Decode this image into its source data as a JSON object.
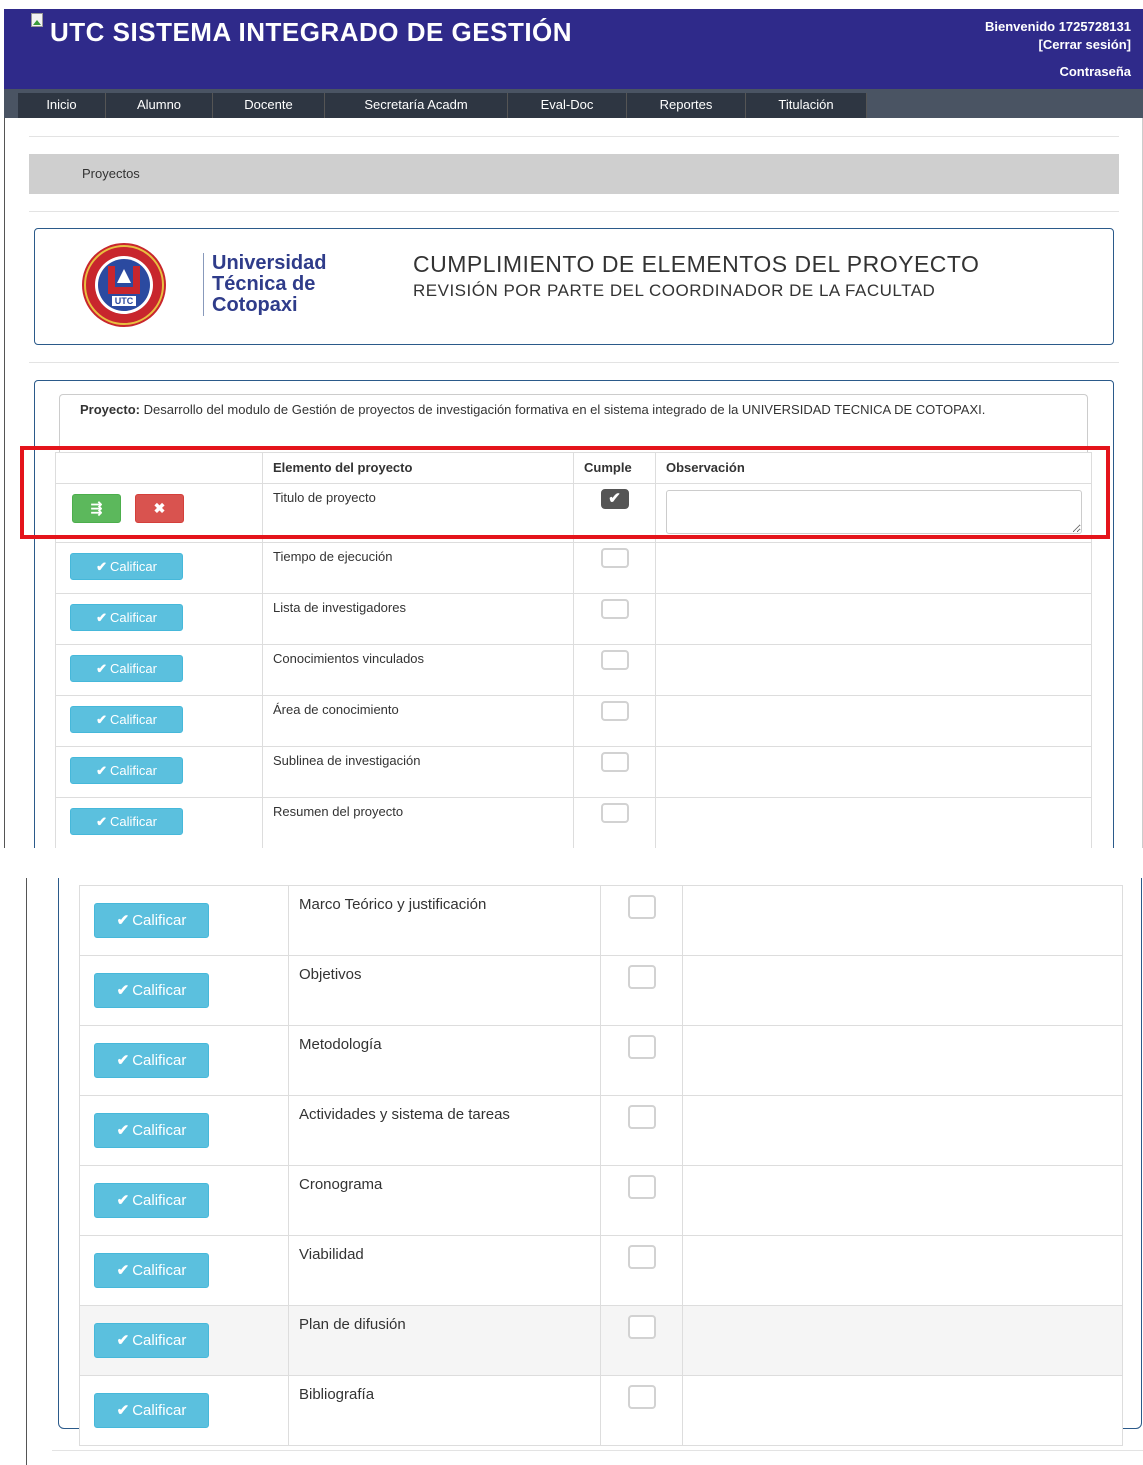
{
  "header": {
    "title": "UTC SISTEMA INTEGRADO DE GESTIÓN",
    "welcome": "Bienvenido 1725728131",
    "logout": "[Cerrar sesión]",
    "password": "Contraseña"
  },
  "nav": [
    "Inicio",
    "Alumno",
    "Docente",
    "Secretaría Acadm",
    "Eval-Doc",
    "Reportes",
    "Titulación"
  ],
  "breadcrumb": "Proyectos",
  "university": {
    "line1": "Universidad",
    "line2": "Técnica de",
    "line3": "Cotopaxi"
  },
  "page": {
    "title": "CUMPLIMIENTO DE ELEMENTOS DEL PROYECTO",
    "subtitle": "REVISIÓN POR PARTE DEL COORDINADOR DE LA FACULTAD"
  },
  "project": {
    "label": "Proyecto:",
    "name": "Desarrollo del modulo de Gestión de proyectos de investigación formativa en el sistema integrado de la UNIVERSIDAD TECNICA DE COTOPAXI."
  },
  "table": {
    "headers": {
      "action": "",
      "element": "Elemento del proyecto",
      "cumple": "Cumple",
      "observacion": "Observación"
    },
    "button_label": "Calificar",
    "rows": [
      {
        "element": "Titulo de proyecto",
        "cumple": true,
        "editing": true
      },
      {
        "element": "Tiempo de ejecución",
        "cumple": false
      },
      {
        "element": "Lista de investigadores",
        "cumple": false
      },
      {
        "element": "Conocimientos vinculados",
        "cumple": false
      },
      {
        "element": "Área de conocimiento",
        "cumple": false
      },
      {
        "element": "Sublinea de investigación",
        "cumple": false
      },
      {
        "element": "Resumen del proyecto",
        "cumple": false
      },
      {
        "element": "Marco Teórico y justificación",
        "cumple": false
      },
      {
        "element": "Objetivos",
        "cumple": false
      },
      {
        "element": "Metodología",
        "cumple": false
      },
      {
        "element": "Actividades y sistema de tareas",
        "cumple": false
      },
      {
        "element": "Cronograma",
        "cumple": false
      },
      {
        "element": "Viabilidad",
        "cumple": false
      },
      {
        "element": "Plan de difusión",
        "cumple": false
      },
      {
        "element": "Bibliografía",
        "cumple": false
      }
    ]
  },
  "colors": {
    "header": "#2f2a8a",
    "navbar": "#2e3642",
    "calificar": "#5bc0de",
    "save": "#5cb85c",
    "cancel": "#d9534f",
    "highlight": "#e4141b"
  },
  "icons": {
    "save": "save-icon",
    "cancel": "times-icon",
    "calificar": "check-icon"
  }
}
